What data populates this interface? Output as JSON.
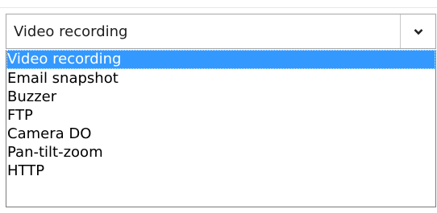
{
  "dropdown": {
    "selected_value": "Video recording",
    "options": [
      "Video recording",
      "Email snapshot",
      "Buzzer",
      "FTP",
      "Camera DO",
      "Pan-tilt-zoom",
      "HTTP"
    ],
    "highlighted_index": 0,
    "highlight_color": "#3399ff",
    "arrow_icon": "chevron-down-icon"
  }
}
